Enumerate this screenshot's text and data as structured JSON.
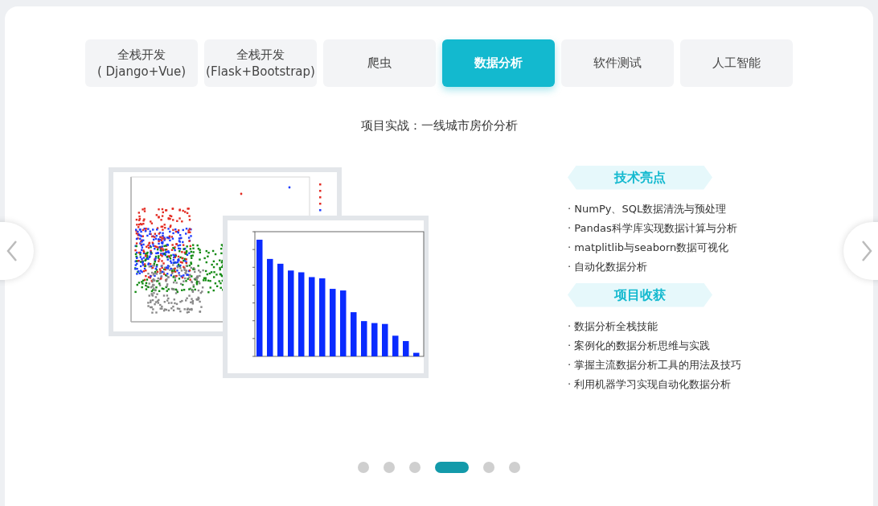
{
  "tabs": [
    {
      "lines": [
        "全栈开发",
        "( Django+Vue)"
      ],
      "selected": false
    },
    {
      "lines": [
        "全栈开发",
        "(Flask+Bootstrap)"
      ],
      "selected": false
    },
    {
      "lines": [
        "爬虫"
      ],
      "selected": false
    },
    {
      "lines": [
        "数据分析"
      ],
      "selected": true
    },
    {
      "lines": [
        "软件测试"
      ],
      "selected": false
    },
    {
      "lines": [
        "人工智能"
      ],
      "selected": false
    }
  ],
  "project_title": "项目实战：一线城市房价分析",
  "sections": [
    {
      "heading": "技术亮点",
      "items": [
        "· NumPy、SQL数据清洗与预处理",
        "· Pandas科学库实现数据计算与分析",
        "· matplitlib与seaborn数据可视化",
        "· 自动化数据分析"
      ]
    },
    {
      "heading": "项目收获",
      "items": [
        "· 数据分析全栈技能",
        "· 案例化的数据分析思维与实践",
        "· 掌握主流数据分析工具的用法及技巧",
        "· 利用机器学习实现自动化数据分析"
      ]
    }
  ],
  "pagination": [
    {
      "selected": false
    },
    {
      "selected": false
    },
    {
      "selected": false
    },
    {
      "selected": true
    },
    {
      "selected": false
    },
    {
      "selected": false
    }
  ]
}
